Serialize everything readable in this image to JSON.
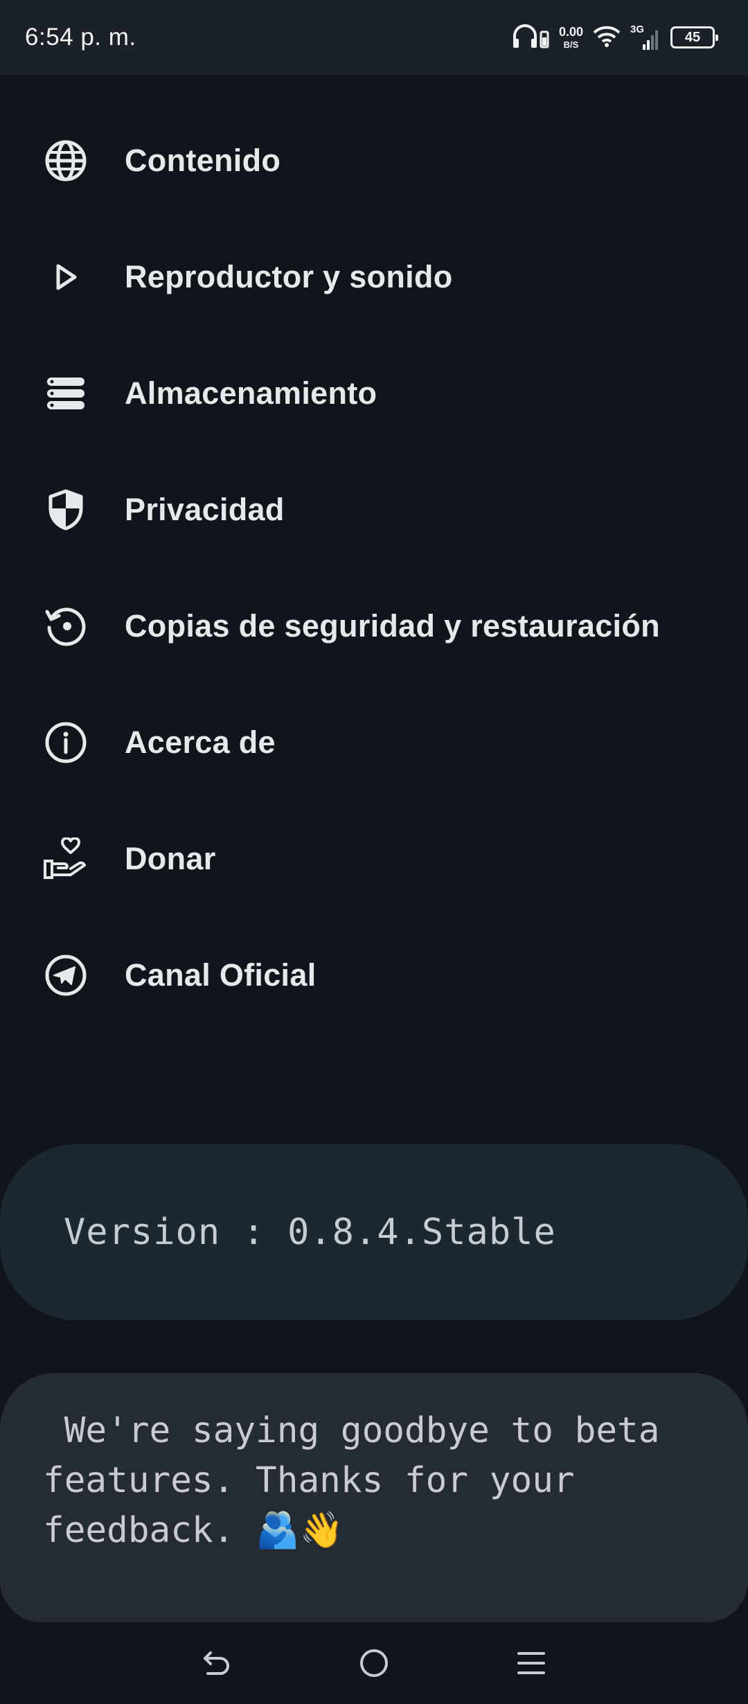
{
  "status_bar": {
    "time": "6:54 p. m.",
    "net_speed_value": "0.00",
    "net_speed_unit": "B/S",
    "network_type": "3G",
    "battery_level": "45"
  },
  "menu": {
    "items": [
      {
        "label": "Contenido",
        "icon": "globe-icon"
      },
      {
        "label": "Reproductor y sonido",
        "icon": "play-icon"
      },
      {
        "label": "Almacenamiento",
        "icon": "storage-icon"
      },
      {
        "label": "Privacidad",
        "icon": "shield-icon"
      },
      {
        "label": "Copias de seguridad y restauración",
        "icon": "restore-icon"
      },
      {
        "label": "Acerca de",
        "icon": "info-icon"
      },
      {
        "label": "Donar",
        "icon": "donate-hand-heart-icon"
      },
      {
        "label": "Canal Oficial",
        "icon": "telegram-icon"
      }
    ]
  },
  "version_card": {
    "text": "Version : 0.8.4.Stable"
  },
  "notice_card": {
    "text": " We're saying goodbye to beta\nfeatures. Thanks for your\nfeedback. 🫂👋"
  },
  "nav_bar": {
    "buttons": [
      "back-icon",
      "home-icon",
      "recents-icon"
    ]
  },
  "colors": {
    "background": "#10151b",
    "status_bar": "#1a2129",
    "version_card": "#1c272f",
    "notice_card": "#242b33",
    "text": "#e6e9ec"
  }
}
